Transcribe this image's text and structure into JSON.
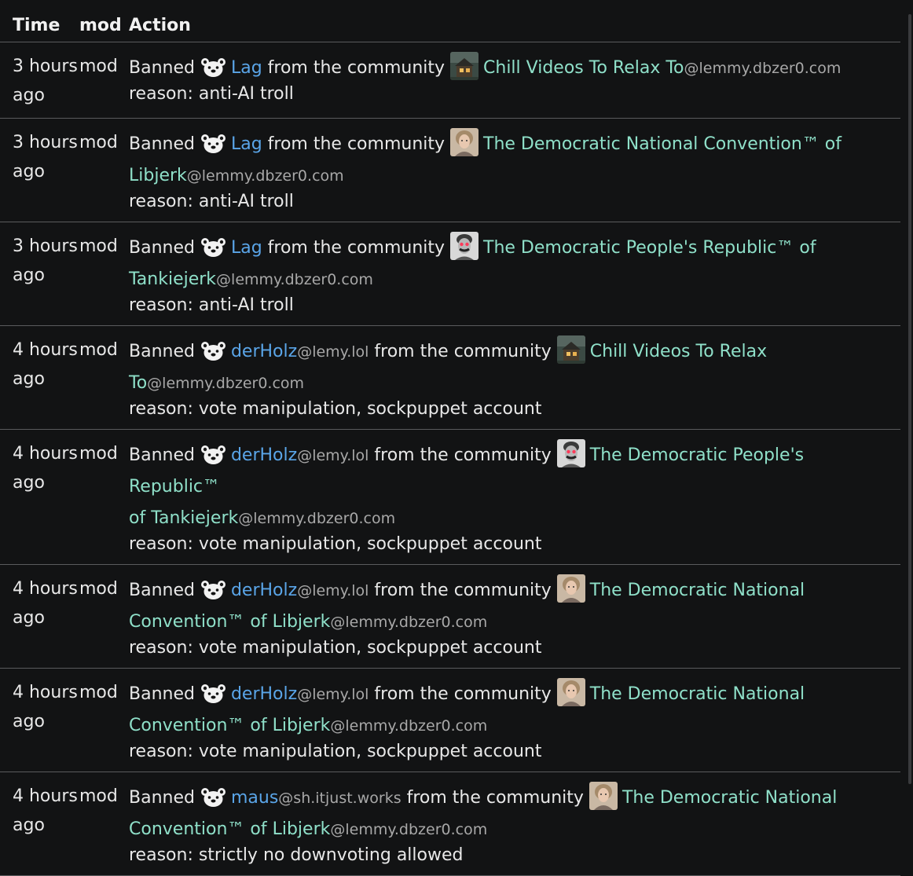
{
  "headers": {
    "time": "Time",
    "mod": "mod",
    "action": "Action"
  },
  "rows": [
    {
      "time1": "3 hours",
      "time2": "ago",
      "mod": "mod",
      "verb": "Banned",
      "user": "Lag",
      "user_inst": "",
      "mid": " from the community ",
      "avatar": "cabin",
      "comm1": "Chill Videos To Relax To",
      "comm2": "",
      "comm_inst": "@lemmy.dbzer0.com",
      "reason": "reason: anti-AI troll"
    },
    {
      "time1": "3 hours",
      "time2": "ago",
      "mod": "mod",
      "verb": "Banned",
      "user": "Lag",
      "user_inst": "",
      "mid": " from the community ",
      "avatar": "woman",
      "comm1": "The Democratic National Convention™ of",
      "comm2": "Libjerk",
      "comm_inst": "@lemmy.dbzer0.com",
      "reason": "reason: anti-AI troll"
    },
    {
      "time1": "3 hours",
      "time2": "ago",
      "mod": "mod",
      "verb": "Banned",
      "user": "Lag",
      "user_inst": "",
      "mid": " from the community ",
      "avatar": "man",
      "comm1": "The Democratic People's Republic™ of",
      "comm2": "Tankiejerk",
      "comm_inst": "@lemmy.dbzer0.com",
      "reason": "reason: anti-AI troll"
    },
    {
      "time1": "4 hours",
      "time2": "ago",
      "mod": "mod",
      "verb": "Banned",
      "user": "derHolz",
      "user_inst": "@lemy.lol",
      "mid": " from the community ",
      "avatar": "cabin",
      "comm1": "Chill Videos To Relax",
      "comm2": "To",
      "comm_inst": "@lemmy.dbzer0.com",
      "reason": "reason: vote manipulation, sockpuppet account"
    },
    {
      "time1": "4 hours",
      "time2": "ago",
      "mod": "mod",
      "verb": "Banned",
      "user": "derHolz",
      "user_inst": "@lemy.lol",
      "mid": " from the community ",
      "avatar": "man",
      "comm1": "The Democratic People's Republic™",
      "comm2": "of Tankiejerk",
      "comm_inst": "@lemmy.dbzer0.com",
      "reason": "reason: vote manipulation, sockpuppet account"
    },
    {
      "time1": "4 hours",
      "time2": "ago",
      "mod": "mod",
      "verb": "Banned",
      "user": "derHolz",
      "user_inst": "@lemy.lol",
      "mid": " from the community ",
      "avatar": "woman",
      "comm1": "The Democratic National",
      "comm2": "Convention™ of Libjerk",
      "comm_inst": "@lemmy.dbzer0.com",
      "reason": "reason: vote manipulation, sockpuppet account"
    },
    {
      "time1": "4 hours",
      "time2": "ago",
      "mod": "mod",
      "verb": "Banned",
      "user": "derHolz",
      "user_inst": "@lemy.lol",
      "mid": " from the community ",
      "avatar": "woman",
      "comm1": "The Democratic National",
      "comm2": "Convention™ of Libjerk",
      "comm_inst": "@lemmy.dbzer0.com",
      "reason": "reason: vote manipulation, sockpuppet account"
    },
    {
      "time1": "4 hours",
      "time2": "ago",
      "mod": "mod",
      "verb": "Banned",
      "user": "maus",
      "user_inst": "@sh.itjust.works",
      "mid": " from the community ",
      "avatar": "woman",
      "comm1": "The Democratic National",
      "comm2": "Convention™ of Libjerk",
      "comm_inst": "@lemmy.dbzer0.com",
      "reason": "reason: strictly no downvoting allowed"
    }
  ],
  "colors": {
    "background": "#121314",
    "user_link": "#5aa5e8",
    "community_link": "#8fe0c9",
    "instance_text": "#a8a8a8",
    "divider": "#5a5b5d"
  },
  "icons": {
    "user_avatar": "bear-mascot-icon",
    "community_avatars": [
      "cabin-icon",
      "woman-portrait-icon",
      "man-portrait-icon"
    ]
  }
}
